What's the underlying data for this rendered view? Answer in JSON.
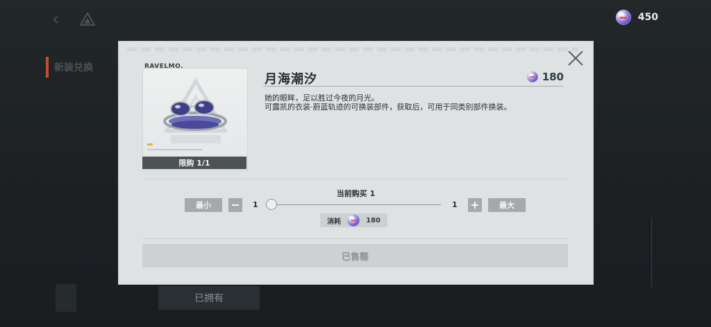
{
  "background": {
    "nav_label": "新装兑换",
    "owned_label": "已拥有"
  },
  "currency": {
    "icon": "coin-icon",
    "amount": "450"
  },
  "modal": {
    "brand": "RAVELMO.",
    "item_name": "月海潮汐",
    "price": "180",
    "description": [
      "她的眼眸，足以胜过今夜的月光。",
      "可露凯的衣装·蔚蓝轨迹的可换装部件，获取后，可用于同类别部件换装。"
    ],
    "limit_label": "限购 1/1",
    "current_buy_label": "当前购买  1",
    "min_label": "最小",
    "max_label": "最大",
    "qty_min": "1",
    "qty_max": "1",
    "slider_fraction": 0,
    "cost_label": "消耗",
    "cost_value": "180",
    "soldout_label": "已售罄"
  },
  "colors": {
    "modal_bg": "#dfe2e3",
    "accent": "#c0502a",
    "button": "#a4a9ac"
  }
}
